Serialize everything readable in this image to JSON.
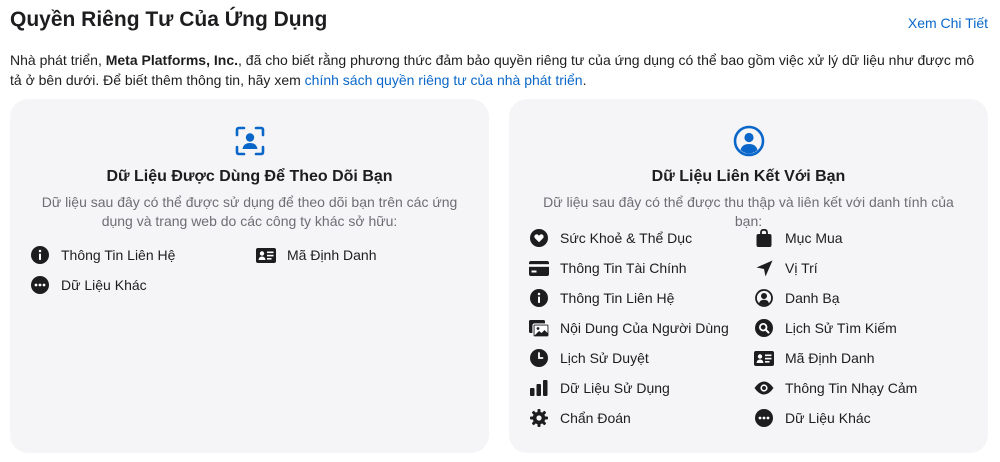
{
  "header": {
    "title": "Quyền Riêng Tư Của Ứng Dụng",
    "see_details": "Xem Chi Tiết"
  },
  "intro": {
    "prefix": "Nhà phát triển, ",
    "developer": "Meta Platforms, Inc.",
    "middle": ", đã cho biết rằng phương thức đảm bảo quyền riêng tư của ứng dụng có thể bao gồm việc xử lý dữ liệu như được mô tả ở bên dưới. Để biết thêm thông tin, hãy xem ",
    "link": "chính sách quyền riêng tư của nhà phát triển",
    "suffix": "."
  },
  "tracking_card": {
    "icon": "tracking-icon",
    "title": "Dữ Liệu Được Dùng Để Theo Dõi Bạn",
    "description": "Dữ liệu sau đây có thể được sử dụng để theo dõi bạn trên các ứng dụng và trang web do các công ty khác sở hữu:",
    "items": [
      {
        "icon": "info-icon",
        "label": "Thông Tin Liên Hệ"
      },
      {
        "icon": "id-card-icon",
        "label": "Mã Định Danh"
      },
      {
        "icon": "ellipsis-icon",
        "label": "Dữ Liệu Khác"
      }
    ]
  },
  "linked_card": {
    "icon": "person-circle-icon",
    "title": "Dữ Liệu Liên Kết Với Bạn",
    "description": "Dữ liệu sau đây có thể được thu thập và liên kết với danh tính của bạn:",
    "left_items": [
      {
        "icon": "heart-icon",
        "label": "Sức Khoẻ & Thể Dục"
      },
      {
        "icon": "credit-card-icon",
        "label": "Thông Tin Tài Chính"
      },
      {
        "icon": "info-icon",
        "label": "Thông Tin Liên Hệ"
      },
      {
        "icon": "photo-icon",
        "label": "Nội Dung Của Người Dùng"
      },
      {
        "icon": "clock-icon",
        "label": "Lịch Sử Duyệt"
      },
      {
        "icon": "bar-chart-icon",
        "label": "Dữ Liệu Sử Dụng"
      },
      {
        "icon": "gear-icon",
        "label": "Chẩn Đoán"
      }
    ],
    "right_items": [
      {
        "icon": "shopping-bag-icon",
        "label": "Mục Mua"
      },
      {
        "icon": "location-arrow-icon",
        "label": "Vị Trí"
      },
      {
        "icon": "contact-icon",
        "label": "Danh Bạ"
      },
      {
        "icon": "search-icon",
        "label": "Lịch Sử Tìm Kiếm"
      },
      {
        "icon": "id-card-icon",
        "label": "Mã Định Danh"
      },
      {
        "icon": "eye-icon",
        "label": "Thông Tin Nhạy Cảm"
      },
      {
        "icon": "ellipsis-icon",
        "label": "Dữ Liệu Khác"
      }
    ]
  },
  "colors": {
    "accent": "#0a67c9",
    "card_background": "#f5f5f7",
    "text": "#1d1d1f",
    "secondary_text": "#6e6e73"
  }
}
